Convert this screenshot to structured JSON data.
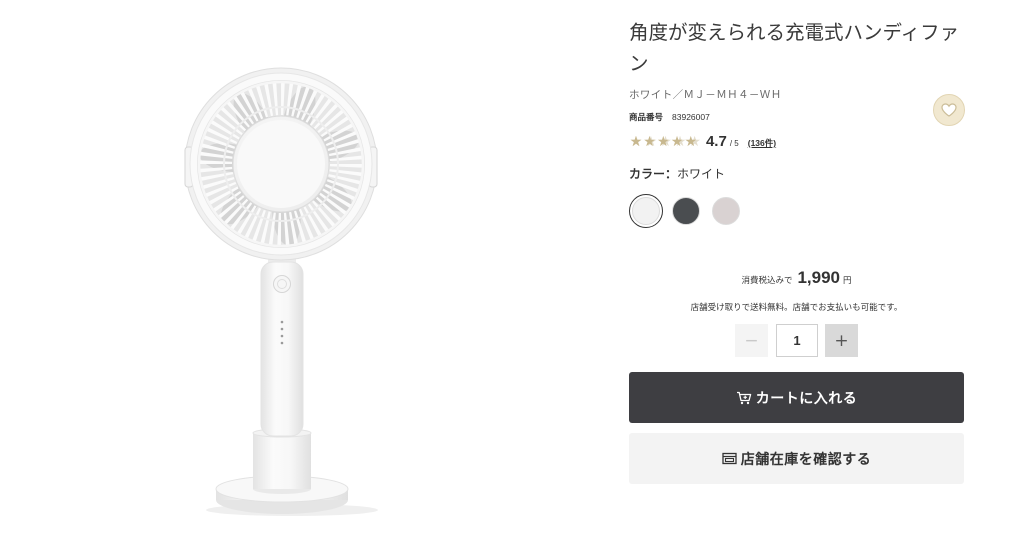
{
  "product": {
    "title": "角度が変えられる充電式ハンディファン",
    "variant": "ホワイト／ＭＪ－ＭＨ４－ＷＨ",
    "sku_label": "商品番号",
    "sku": "83926007",
    "favorite_icon": "heart-icon"
  },
  "rating": {
    "stars": 4.7,
    "value": "4.7",
    "scale": "/ 5",
    "count": "(136件)",
    "star_icon": "star-icon"
  },
  "color": {
    "label": "カラー：",
    "selected": "ホワイト",
    "swatches": [
      {
        "hex": "#f2f2f2",
        "selected": true
      },
      {
        "hex": "#4a4d50",
        "selected": false
      },
      {
        "hex": "#d9d2d2",
        "selected": false
      }
    ]
  },
  "price": {
    "prefix": "消費税込みで",
    "amount": "1,990",
    "unit": "円",
    "note": "店舗受け取りで送料無料。店舗でお支払いも可能です。"
  },
  "quantity": {
    "minus": "−",
    "value": "1",
    "plus": "+"
  },
  "actions": {
    "cart_label": "カートに入れる",
    "cart_icon": "cart-icon",
    "stock_label": "店舗在庫を確認する",
    "stock_icon": "store-icon"
  },
  "theme": {
    "primary_button": "#3e3e42",
    "secondary_button": "#f3f3f3",
    "star_color": "#c8b88f",
    "favorite_bg": "#f1e8d0"
  }
}
